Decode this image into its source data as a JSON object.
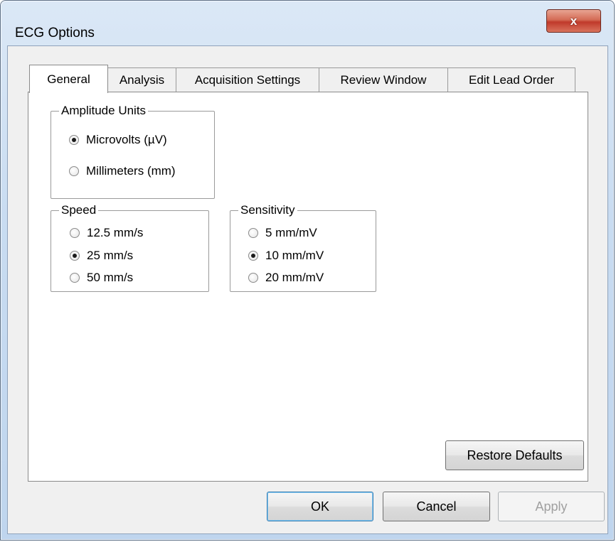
{
  "window": {
    "title": "ECG Options",
    "close_label": "x"
  },
  "tabs": [
    {
      "label": "General",
      "active": true
    },
    {
      "label": "Analysis",
      "active": false
    },
    {
      "label": "Acquisition Settings",
      "active": false
    },
    {
      "label": "Review Window",
      "active": false
    },
    {
      "label": "Edit Lead Order",
      "active": false
    }
  ],
  "amplitude_units": {
    "label": "Amplitude Units",
    "options": [
      {
        "label": "Microvolts (µV)",
        "checked": true
      },
      {
        "label": "Millimeters (mm)",
        "checked": false
      }
    ]
  },
  "speed": {
    "label": "Speed",
    "options": [
      {
        "label": "12.5 mm/s",
        "checked": false
      },
      {
        "label": "25 mm/s",
        "checked": true
      },
      {
        "label": "50 mm/s",
        "checked": false
      }
    ]
  },
  "sensitivity": {
    "label": "Sensitivity",
    "options": [
      {
        "label": "5 mm/mV",
        "checked": false
      },
      {
        "label": "10 mm/mV",
        "checked": true
      },
      {
        "label": "20 mm/mV",
        "checked": false
      }
    ]
  },
  "buttons": {
    "restore_defaults": "Restore Defaults",
    "ok": "OK",
    "cancel": "Cancel",
    "apply": "Apply",
    "apply_enabled": false
  }
}
